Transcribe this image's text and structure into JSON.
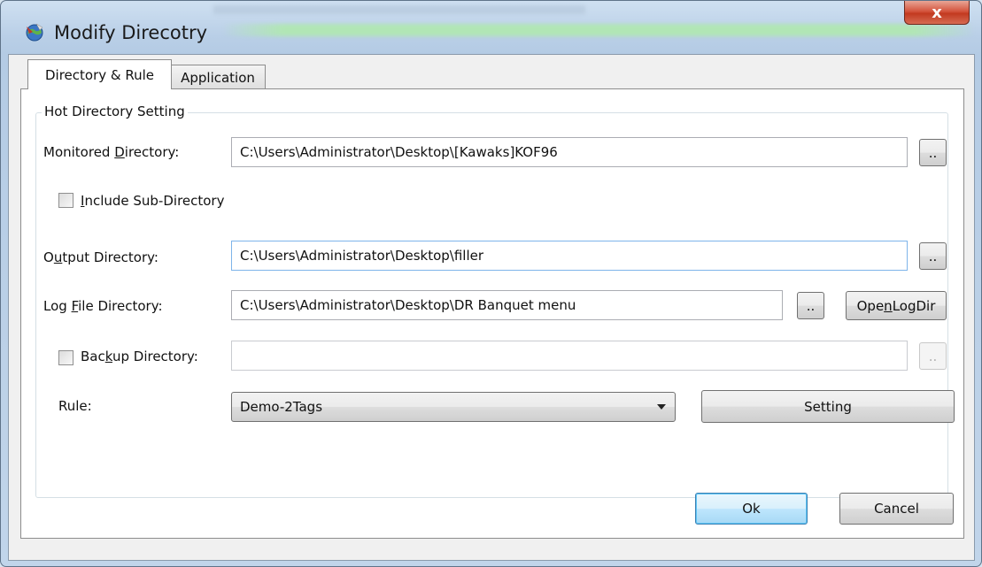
{
  "window": {
    "title": "Modify Direcotry",
    "close_glyph": "x"
  },
  "tabs": [
    {
      "label": "Directory & Rule",
      "active": true
    },
    {
      "label": "Application",
      "active": false
    }
  ],
  "group": {
    "label": "Hot Directory Setting"
  },
  "monitored": {
    "label_pre": "Monitored ",
    "label_key": "D",
    "label_post": "irectory:",
    "value": "C:\\Users\\Administrator\\Desktop\\[Kawaks]KOF96",
    "browse_label": ".."
  },
  "include_sub": {
    "label_pre": "",
    "label_key": "I",
    "label_post": "nclude Sub-Directory",
    "checked": false
  },
  "output": {
    "label_pre": "O",
    "label_key": "u",
    "label_post": "tput Directory:",
    "value": "C:\\Users\\Administrator\\Desktop\\filler",
    "browse_label": ".."
  },
  "logfile": {
    "label_pre": "Log ",
    "label_key": "F",
    "label_post": "ile Directory:",
    "value": "C:\\Users\\Administrator\\Desktop\\DR Banquet menu",
    "browse_label": "..",
    "open_pre": "Ope",
    "open_key": "n",
    "open_post": " LogDir"
  },
  "backup": {
    "label_pre": "Bac",
    "label_key": "k",
    "label_post": "up Directory:",
    "checked": false,
    "value": "",
    "browse_label": ".."
  },
  "rule": {
    "label": "Rule:",
    "selected": "Demo-2Tags",
    "setting_label": "Setting"
  },
  "footer": {
    "ok_label": "Ok",
    "cancel_label": "Cancel"
  },
  "icons": {
    "app": "globe-icon",
    "dropdown": "chevron-down-icon",
    "close": "close-icon"
  }
}
